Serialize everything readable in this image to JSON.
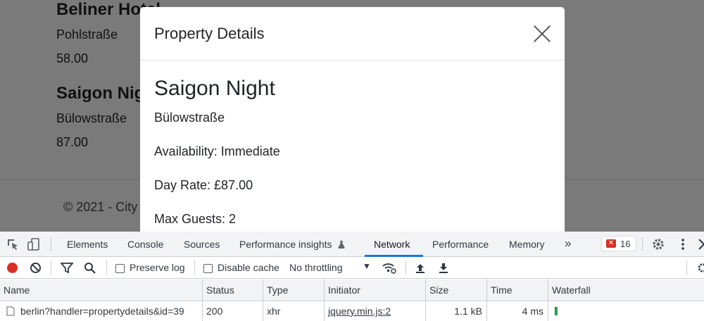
{
  "page": {
    "listings": [
      {
        "name": "Beliner Hotel",
        "street": "Pohlstraße",
        "price": "58.00"
      },
      {
        "name": "Saigon Nig",
        "street": "Bülowstraße",
        "price": "87.00"
      }
    ],
    "footer": "© 2021 - City"
  },
  "modal": {
    "title": "Property Details",
    "property_name": "Saigon Night",
    "street": "Bülowstraße",
    "availability": "Availability: Immediate",
    "day_rate": "Day Rate: £87.00",
    "max_guests": "Max Guests: 2"
  },
  "devtools": {
    "tabs": [
      "Elements",
      "Console",
      "Sources",
      "Performance insights",
      "Network",
      "Performance",
      "Memory"
    ],
    "active_tab": "Network",
    "more": "»",
    "error_count": "16",
    "toolbar": {
      "preserve_log": "Preserve log",
      "disable_cache": "Disable cache",
      "throttling": "No throttling"
    },
    "columns": [
      "Name",
      "Status",
      "Type",
      "Initiator",
      "Size",
      "Time",
      "Waterfall"
    ],
    "rows": [
      {
        "name": "berlin?handler=propertydetails&id=39",
        "status": "200",
        "type": "xhr",
        "initiator": "jquery.min.js:2",
        "size": "1.1 kB",
        "time": "4 ms"
      }
    ],
    "colors": {
      "accent": "#1a73e8",
      "record": "#d93025",
      "waterfall": "#34a853"
    }
  }
}
